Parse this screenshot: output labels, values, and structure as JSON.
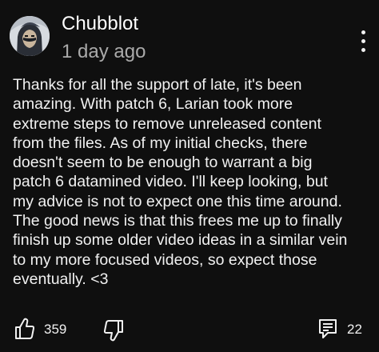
{
  "comment": {
    "author": "Chubblot",
    "timestamp": "1 day ago",
    "body_lines": [
      "Thanks for all the support of late, it's been",
      "amazing. With patch 6, Larian took more",
      "extreme steps to remove unreleased content",
      "from the files. As of my initial checks, there",
      "doesn't seem to be enough to warrant a big",
      "patch 6 datamined video. I'll keep looking, but",
      "my advice is not to expect one this time around.",
      "The good news is that this frees me up to finally",
      "finish up some older video ideas in a similar vein",
      "to my more focused videos, so expect those",
      "eventually. <3"
    ]
  },
  "actions": {
    "like_count": "359",
    "reply_count": "22",
    "icons": {
      "like": "thumbs-up-icon",
      "dislike": "thumbs-down-icon",
      "reply": "comment-bubble-icon",
      "menu": "more-vertical-icon"
    }
  },
  "colors": {
    "background": "#0f0f0f",
    "primary_text": "#f1f1f1",
    "secondary_text": "#aaaaaa"
  }
}
